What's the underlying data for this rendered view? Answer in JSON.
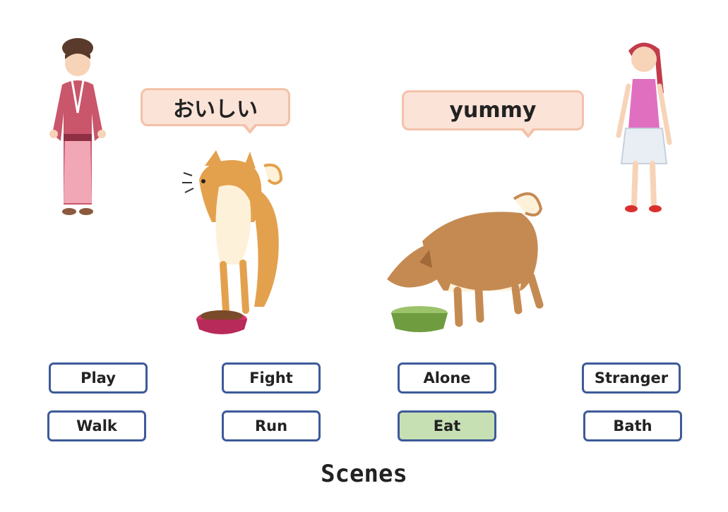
{
  "bubbles": {
    "left": "おいしい",
    "right": "yummy"
  },
  "buttons": [
    {
      "label": "Play",
      "selected": false
    },
    {
      "label": "Fight",
      "selected": false
    },
    {
      "label": "Alone",
      "selected": false
    },
    {
      "label": "Stranger",
      "selected": false
    },
    {
      "label": "Walk",
      "selected": false
    },
    {
      "label": "Run",
      "selected": false
    },
    {
      "label": "Eat",
      "selected": true
    },
    {
      "label": "Bath",
      "selected": false
    }
  ],
  "title": "Scenes",
  "colors": {
    "selected_fill": "#c6e0b4",
    "button_border": "#3d5a99",
    "bubble_fill": "#fbe3d7",
    "bubble_border": "#f3c2a9"
  }
}
